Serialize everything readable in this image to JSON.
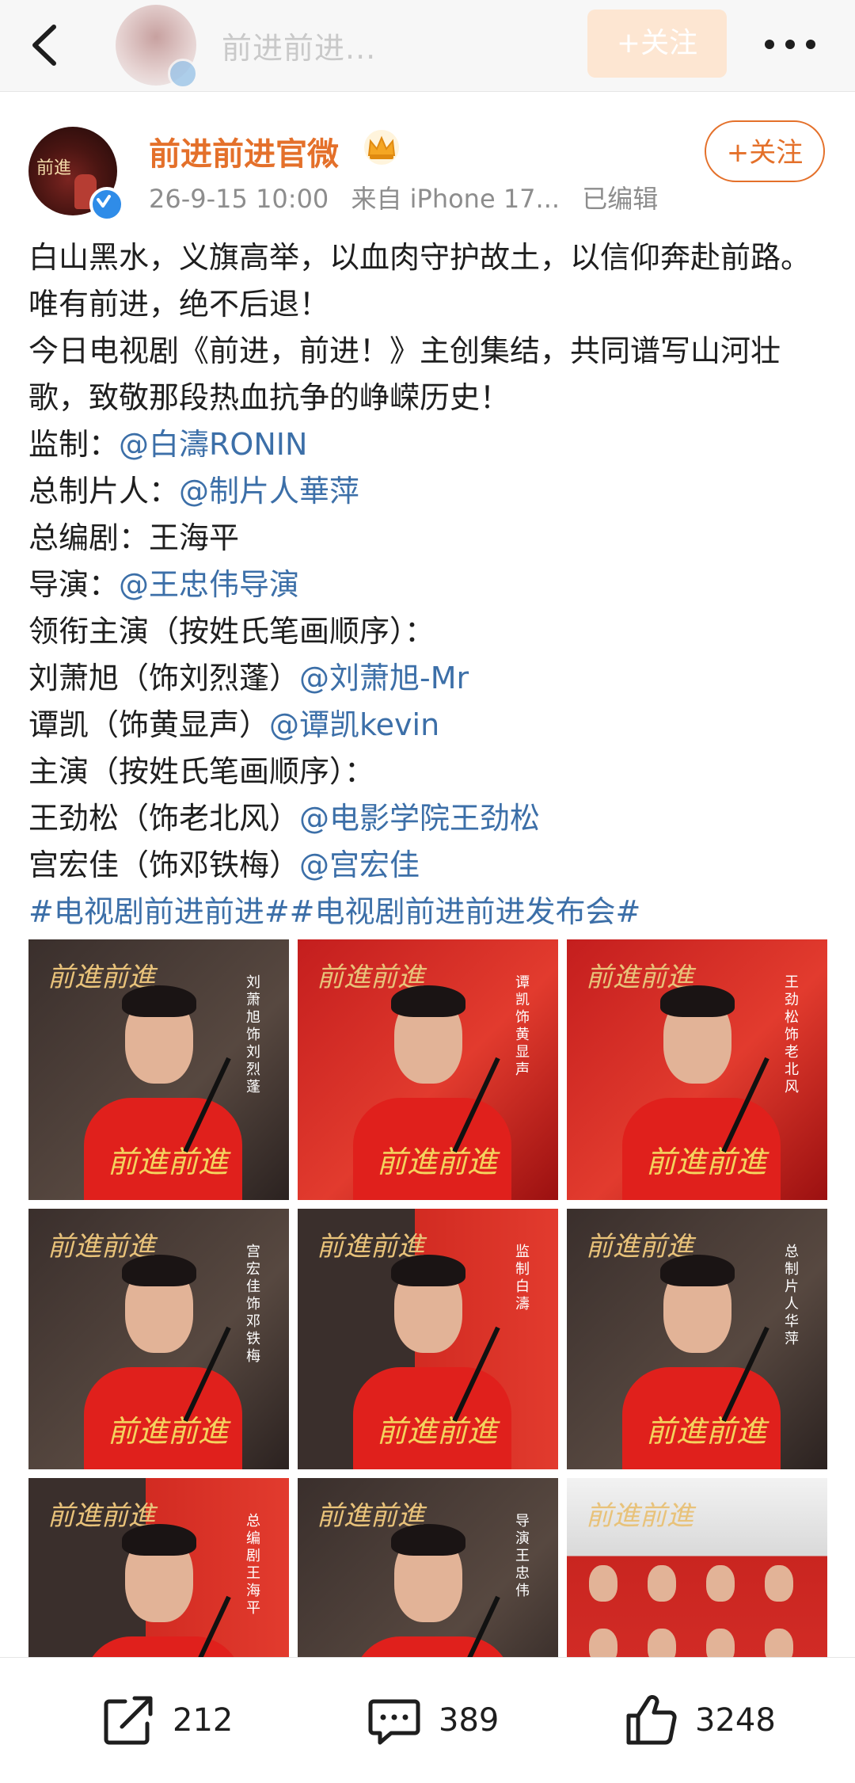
{
  "topbar": {
    "name": "前进前进...",
    "follow_label": "+关注"
  },
  "post": {
    "author": "前进前进官微",
    "date": "26-9-15 10:00",
    "source": "来自 iPhone 17...",
    "edited": "已编辑",
    "follow_label": "+关注",
    "para1": "白山黑水，义旗高举，以血肉守护故土，以信仰奔赴前路。唯有前进，绝不后退！",
    "para2": "今日电视剧《前进，前进！》主创集结，共同谱写山河壮歌，致敬那段热血抗争的峥嵘历史！",
    "credits": [
      {
        "label": "监制：",
        "plain": "",
        "mention": "@白濤RONIN"
      },
      {
        "label": "总制片人：",
        "plain": "",
        "mention": "@制片人華萍"
      },
      {
        "label": "总编剧：",
        "plain": "王海平",
        "mention": ""
      },
      {
        "label": "导演：",
        "plain": "",
        "mention": "@王忠伟导演"
      },
      {
        "label": "领衔主演（按姓氏笔画顺序）：",
        "plain": "",
        "mention": ""
      },
      {
        "label": "刘萧旭（饰刘烈蓬）",
        "plain": "",
        "mention": "@刘萧旭-Mr"
      },
      {
        "label": "谭凯（饰黄显声）",
        "plain": "",
        "mention": "@谭凯kevin"
      },
      {
        "label": "主演（按姓氏笔画顺序）：",
        "plain": "",
        "mention": ""
      },
      {
        "label": "王劲松（饰老北风）",
        "plain": "",
        "mention": "@电影学院王劲松"
      },
      {
        "label": "宫宏佳（饰邓铁梅）",
        "plain": "",
        "mention": "@宫宏佳"
      }
    ],
    "hashtags": "#电视剧前进前进##电视剧前进前进发布会#"
  },
  "photos": [
    {
      "brand": "前進前進",
      "caption": "刘萧旭饰刘烈蓬",
      "style": "dark"
    },
    {
      "brand": "前進前進",
      "caption": "谭凯饰黄显声",
      "style": "red"
    },
    {
      "brand": "前進前進",
      "caption": "王劲松饰老北风",
      "style": "red"
    },
    {
      "brand": "前進前進",
      "caption": "宫宏佳饰邓铁梅",
      "style": "dark"
    },
    {
      "brand": "前進前進",
      "caption": "监制白濤",
      "style": "mixed"
    },
    {
      "brand": "前進前進",
      "caption": "总制片人华萍",
      "style": "dark"
    },
    {
      "brand": "前進前進",
      "caption": "总编剧王海平",
      "style": "mixed"
    },
    {
      "brand": "前進前進",
      "caption": "导演王忠伟",
      "style": "dark"
    },
    {
      "brand": "前進前進",
      "caption": "",
      "style": "group"
    }
  ],
  "actions": {
    "share_count": "212",
    "comment_count": "389",
    "like_count": "3248"
  },
  "icons": [
    "back-arrow-icon",
    "more-dots-icon",
    "verified-badge-icon",
    "crown-icon",
    "share-icon",
    "comment-icon",
    "like-icon"
  ],
  "colors": {
    "accent": "#e4702a",
    "link": "#3c6fa8",
    "verified": "#2f8ce8"
  }
}
